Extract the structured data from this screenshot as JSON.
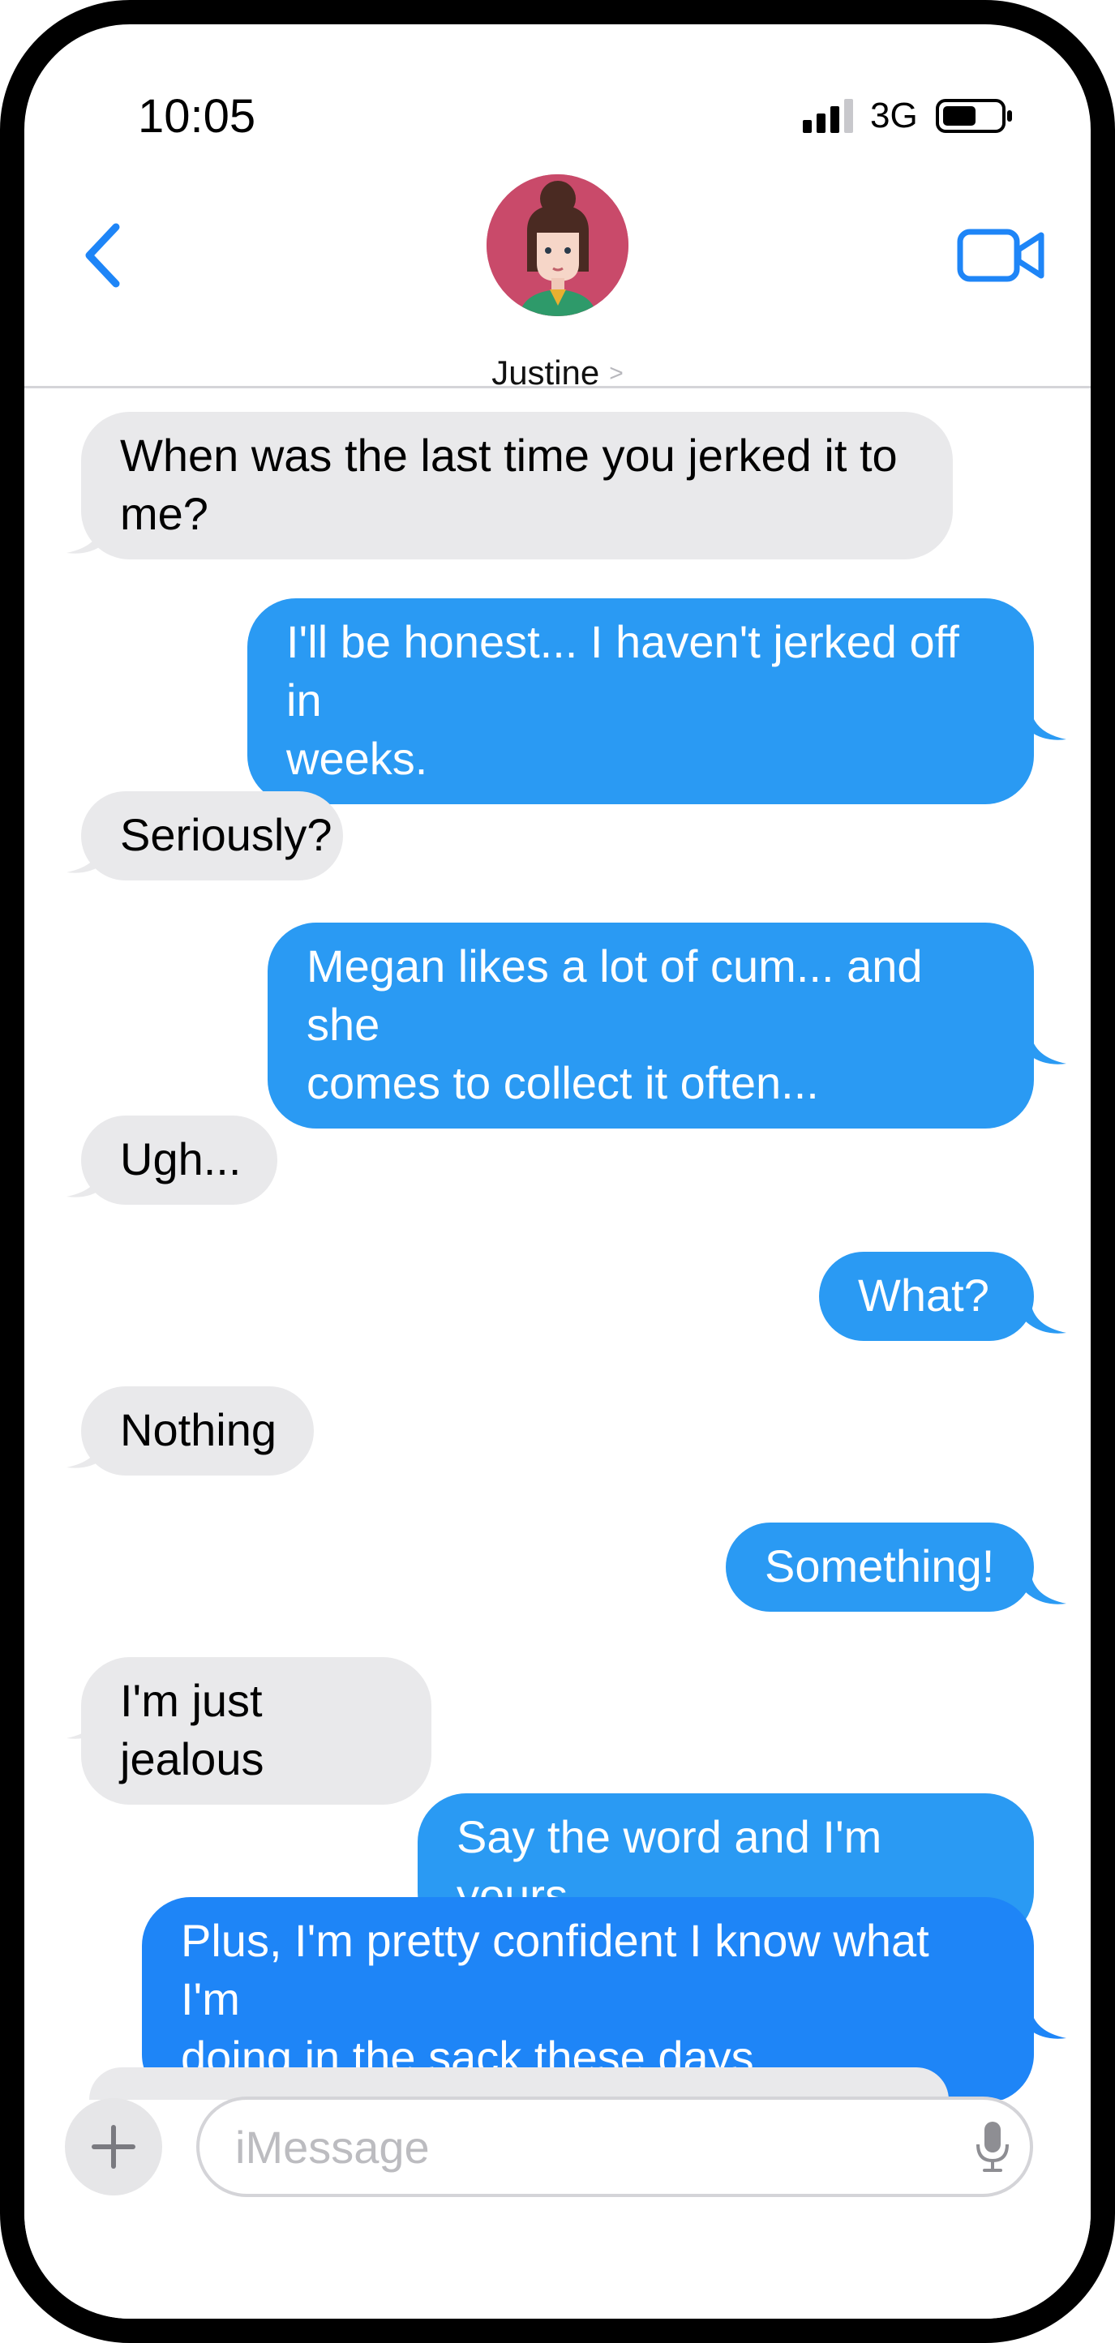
{
  "status_bar": {
    "time": "10:05",
    "network": "3G",
    "icons": [
      "signal-icon",
      "battery-icon"
    ]
  },
  "header": {
    "contact_name": "Justine",
    "icons": [
      "back-chevron-icon",
      "video-call-icon",
      "contact-avatar"
    ]
  },
  "colors": {
    "incoming_bubble": "#e9e9eb",
    "outgoing_bubble": "#2a9af3",
    "accent": "#1e85f7"
  },
  "messages": [
    {
      "direction": "incoming",
      "text": "When was the last time you jerked it to\nme?"
    },
    {
      "direction": "outgoing",
      "text": "I'll be honest... I haven't jerked off in\nweeks."
    },
    {
      "direction": "incoming",
      "text": "Seriously?"
    },
    {
      "direction": "outgoing",
      "text": "Megan likes a lot of cum... and she\ncomes to collect it often..."
    },
    {
      "direction": "incoming",
      "text": "Ugh..."
    },
    {
      "direction": "outgoing",
      "text": "What?"
    },
    {
      "direction": "incoming",
      "text": "Nothing"
    },
    {
      "direction": "outgoing",
      "text": "Something!"
    },
    {
      "direction": "incoming",
      "text": "I'm just jealous"
    },
    {
      "direction": "outgoing",
      "text": "Say the word and I'm yours"
    },
    {
      "direction": "outgoing",
      "text": "Plus, I'm pretty confident I know what I'm\ndoing in the sack these days"
    }
  ],
  "composer": {
    "placeholder": "iMessage",
    "value": "",
    "icons": [
      "plus-icon",
      "microphone-icon"
    ]
  }
}
